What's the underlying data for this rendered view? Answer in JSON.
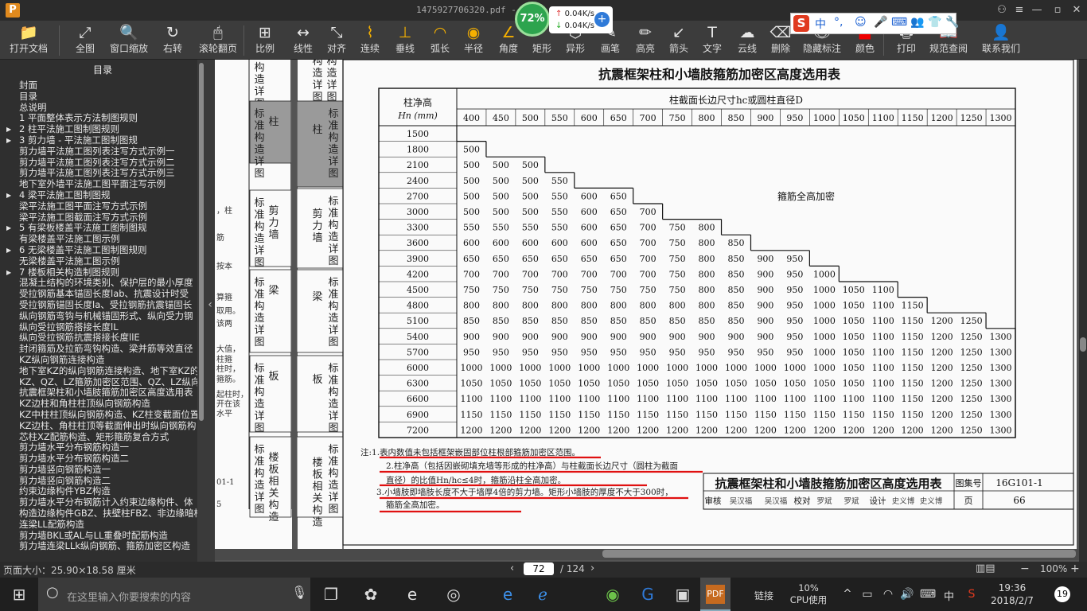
{
  "window": {
    "title": "1475927706320.pdf - P",
    "logo": "P"
  },
  "net_monitor": {
    "percent": "72%",
    "up": "0.04K/s",
    "down": "0.04K/s"
  },
  "ime": {
    "brand": "S",
    "items": [
      "中",
      "°,",
      "☺",
      "🎤",
      "⌨",
      "👥",
      "👕",
      "🔧"
    ]
  },
  "toolbar": [
    {
      "id": "open",
      "icon": "📁",
      "label": "打开文档"
    },
    {
      "id": "fit-all",
      "icon": "⤢",
      "label": "全图"
    },
    {
      "id": "window-zoom",
      "icon": "🔍",
      "label": "窗口缩放"
    },
    {
      "id": "rotate",
      "icon": "↻",
      "label": "右转"
    },
    {
      "id": "scroll-page",
      "icon": "🖱",
      "label": "滚轮翻页"
    },
    {
      "id": "scale",
      "icon": "⊞",
      "label": "比例"
    },
    {
      "id": "linear",
      "icon": "↔",
      "label": "线性"
    },
    {
      "id": "align",
      "icon": "⤡",
      "label": "对齐"
    },
    {
      "id": "continuous",
      "icon": "⌇",
      "label": "连续"
    },
    {
      "id": "perpendicular",
      "icon": "⊥",
      "label": "垂线"
    },
    {
      "id": "arc-length",
      "icon": "◠",
      "label": "弧长"
    },
    {
      "id": "radius",
      "icon": "◉",
      "label": "半径"
    },
    {
      "id": "angle",
      "icon": "∠",
      "label": "角度"
    },
    {
      "id": "rect",
      "icon": "",
      "label": "矩形"
    },
    {
      "id": "polygon",
      "icon": "⬡",
      "label": "异形"
    },
    {
      "id": "brush",
      "icon": "✎",
      "label": "画笔"
    },
    {
      "id": "highlight",
      "icon": "✏",
      "label": "高亮"
    },
    {
      "id": "arrow",
      "icon": "↙",
      "label": "箭头"
    },
    {
      "id": "text",
      "icon": "T",
      "label": "文字"
    },
    {
      "id": "cloud",
      "icon": "☁",
      "label": "云线"
    },
    {
      "id": "erase",
      "icon": "⌫",
      "label": "删除"
    },
    {
      "id": "hide-marks",
      "icon": "👁",
      "label": "隐藏标注"
    },
    {
      "id": "color",
      "icon": "■",
      "label": "颜色"
    },
    {
      "id": "print",
      "icon": "🖶",
      "label": "打印"
    },
    {
      "id": "code-lookup",
      "icon": "📖",
      "label": "规范查阅"
    },
    {
      "id": "contact",
      "icon": "👤",
      "label": "联系我们"
    }
  ],
  "sidebar": {
    "title": "目录",
    "items": [
      {
        "label": "封面",
        "arrow": ""
      },
      {
        "label": "目录",
        "arrow": ""
      },
      {
        "label": "总说明",
        "arrow": ""
      },
      {
        "label": "1 平面整体表示方法制图规则",
        "arrow": ""
      },
      {
        "label": "2 柱平法施工图制图规则",
        "arrow": "▶"
      },
      {
        "label": "3 剪力墙 - 平法施工图制图规",
        "arrow": "▶"
      },
      {
        "label": "剪力墙平法施工图列表注写方式示例一",
        "arrow": ""
      },
      {
        "label": "剪力墙平法施工图列表注写方式示例二",
        "arrow": ""
      },
      {
        "label": "剪力墙平法施工图列表注写方式示例三",
        "arrow": ""
      },
      {
        "label": "地下室外墙平法施工图平面注写示例",
        "arrow": ""
      },
      {
        "label": "4 梁平法施工图制图规",
        "arrow": "▶"
      },
      {
        "label": "梁平法施工图平面注写方式示例",
        "arrow": ""
      },
      {
        "label": "梁平法施工图截面注写方式示例",
        "arrow": ""
      },
      {
        "label": "5 有梁板楼盖平法施工图制图规",
        "arrow": "▶"
      },
      {
        "label": "有梁楼盖平法施工图示例",
        "arrow": ""
      },
      {
        "label": "6 无梁楼盖平法施工图制图规则",
        "arrow": "▶"
      },
      {
        "label": "无梁楼盖平法施工图示例",
        "arrow": ""
      },
      {
        "label": "7 楼板相关构造制图规则",
        "arrow": "▶"
      },
      {
        "label": "混凝土结构的环境类别、保护层的最小厚度",
        "arrow": ""
      },
      {
        "label": "受拉钢筋基本锚固长度lab、抗震设计时受",
        "arrow": ""
      },
      {
        "label": "受拉钢筋锚固长度la、受拉钢筋抗震锚固长",
        "arrow": ""
      },
      {
        "label": "纵向钢筋弯钩与机械锚固形式、纵向受力钢",
        "arrow": ""
      },
      {
        "label": "纵向受拉钢筋搭接长度lL",
        "arrow": ""
      },
      {
        "label": "纵向受拉钢筋抗震搭接长度llE",
        "arrow": ""
      },
      {
        "label": "封闭箍筋及拉筋弯钩构造、梁并筋等效直径",
        "arrow": ""
      },
      {
        "label": "KZ纵向钢筋连接构造",
        "arrow": ""
      },
      {
        "label": "地下室KZ的纵向钢筋连接构造、地下室KZ的",
        "arrow": ""
      },
      {
        "label": "KZ、QZ、LZ箍筋加密区范围、QZ、LZ纵向钢",
        "arrow": ""
      },
      {
        "label": "抗震框架柱和小墙肢箍筋加密区高度选用表",
        "arrow": ""
      },
      {
        "label": "KZ边柱和角柱柱顶纵向钢筋构造",
        "arrow": ""
      },
      {
        "label": "KZ中柱柱顶纵向钢筋构造、KZ柱变截面位置",
        "arrow": ""
      },
      {
        "label": "KZ边柱、角柱柱顶等截面伸出时纵向钢筋构",
        "arrow": ""
      },
      {
        "label": "芯柱XZ配筋构造、矩形箍筋复合方式",
        "arrow": ""
      },
      {
        "label": "剪力墙水平分布钢筋构造一",
        "arrow": ""
      },
      {
        "label": "剪力墙水平分布钢筋构造二",
        "arrow": ""
      },
      {
        "label": "剪力墙竖向钢筋构造一",
        "arrow": ""
      },
      {
        "label": "剪力墙竖向钢筋构造二",
        "arrow": ""
      },
      {
        "label": "约束边缘构件YBZ构造",
        "arrow": ""
      },
      {
        "label": "剪力墙水平分布钢筋计入约束边缘构件、体",
        "arrow": ""
      },
      {
        "label": "构造边缘构件GBZ、扶壁柱FBZ、非边缘暗柱",
        "arrow": ""
      },
      {
        "label": "连梁LL配筋构造",
        "arrow": ""
      },
      {
        "label": "剪力墙BKL或AL与LL重叠时配筋构造",
        "arrow": ""
      },
      {
        "label": "剪力墙连梁LLk纵向钢筋、箍筋加密区构造",
        "arrow": ""
      }
    ]
  },
  "doc": {
    "table_title": "抗震框架柱和小墙肢箍筋加密区高度选用表",
    "corner_line1": "柱净高",
    "corner_line2": "Hn (mm)",
    "header_label": "柱截面长边尺寸hc或圆柱直径D",
    "full_label": "箍筋全高加密",
    "columns": [
      "400",
      "450",
      "500",
      "550",
      "600",
      "650",
      "700",
      "750",
      "800",
      "850",
      "900",
      "950",
      "1000",
      "1050",
      "1100",
      "1150",
      "1200",
      "1250",
      "1300"
    ],
    "rows": [
      {
        "h": "1500",
        "v": []
      },
      {
        "h": "1800",
        "v": [
          "500"
        ]
      },
      {
        "h": "2100",
        "v": [
          "500",
          "500",
          "500"
        ]
      },
      {
        "h": "2400",
        "v": [
          "500",
          "500",
          "500",
          "550"
        ]
      },
      {
        "h": "2700",
        "v": [
          "500",
          "500",
          "500",
          "550",
          "600",
          "650"
        ]
      },
      {
        "h": "3000",
        "v": [
          "500",
          "500",
          "500",
          "550",
          "600",
          "650",
          "700"
        ]
      },
      {
        "h": "3300",
        "v": [
          "550",
          "550",
          "550",
          "550",
          "600",
          "650",
          "700",
          "750",
          "800"
        ]
      },
      {
        "h": "3600",
        "v": [
          "600",
          "600",
          "600",
          "600",
          "600",
          "650",
          "700",
          "750",
          "800",
          "850"
        ]
      },
      {
        "h": "3900",
        "v": [
          "650",
          "650",
          "650",
          "650",
          "650",
          "650",
          "700",
          "750",
          "800",
          "850",
          "900",
          "950"
        ]
      },
      {
        "h": "4200",
        "v": [
          "700",
          "700",
          "700",
          "700",
          "700",
          "700",
          "700",
          "750",
          "800",
          "850",
          "900",
          "950",
          "1000"
        ]
      },
      {
        "h": "4500",
        "v": [
          "750",
          "750",
          "750",
          "750",
          "750",
          "750",
          "750",
          "750",
          "800",
          "850",
          "900",
          "950",
          "1000",
          "1050",
          "1100"
        ]
      },
      {
        "h": "4800",
        "v": [
          "800",
          "800",
          "800",
          "800",
          "800",
          "800",
          "800",
          "800",
          "800",
          "850",
          "900",
          "950",
          "1000",
          "1050",
          "1100",
          "1150"
        ]
      },
      {
        "h": "5100",
        "v": [
          "850",
          "850",
          "850",
          "850",
          "850",
          "850",
          "850",
          "850",
          "850",
          "850",
          "900",
          "950",
          "1000",
          "1050",
          "1100",
          "1150",
          "1200",
          "1250"
        ]
      },
      {
        "h": "5400",
        "v": [
          "900",
          "900",
          "900",
          "900",
          "900",
          "900",
          "900",
          "900",
          "900",
          "900",
          "900",
          "950",
          "1000",
          "1050",
          "1100",
          "1150",
          "1200",
          "1250",
          "1300"
        ]
      },
      {
        "h": "5700",
        "v": [
          "950",
          "950",
          "950",
          "950",
          "950",
          "950",
          "950",
          "950",
          "950",
          "950",
          "950",
          "950",
          "1000",
          "1050",
          "1100",
          "1150",
          "1200",
          "1250",
          "1300"
        ]
      },
      {
        "h": "6000",
        "v": [
          "1000",
          "1000",
          "1000",
          "1000",
          "1000",
          "1000",
          "1000",
          "1000",
          "1000",
          "1000",
          "1000",
          "1000",
          "1000",
          "1050",
          "1100",
          "1150",
          "1200",
          "1250",
          "1300"
        ]
      },
      {
        "h": "6300",
        "v": [
          "1050",
          "1050",
          "1050",
          "1050",
          "1050",
          "1050",
          "1050",
          "1050",
          "1050",
          "1050",
          "1050",
          "1050",
          "1050",
          "1050",
          "1100",
          "1150",
          "1200",
          "1250",
          "1300"
        ]
      },
      {
        "h": "6600",
        "v": [
          "1100",
          "1100",
          "1100",
          "1100",
          "1100",
          "1100",
          "1100",
          "1100",
          "1100",
          "1100",
          "1100",
          "1100",
          "1100",
          "1100",
          "1100",
          "1150",
          "1200",
          "1250",
          "1300"
        ]
      },
      {
        "h": "6900",
        "v": [
          "1150",
          "1150",
          "1150",
          "1150",
          "1150",
          "1150",
          "1150",
          "1150",
          "1150",
          "1150",
          "1150",
          "1150",
          "1150",
          "1150",
          "1150",
          "1150",
          "1200",
          "1250",
          "1300"
        ]
      },
      {
        "h": "7200",
        "v": [
          "1200",
          "1200",
          "1200",
          "1200",
          "1200",
          "1200",
          "1200",
          "1200",
          "1200",
          "1200",
          "1200",
          "1200",
          "1200",
          "1200",
          "1200",
          "1200",
          "1200",
          "1250",
          "1300"
        ]
      }
    ],
    "notes": [
      "注:1.表内数值未包括框架嵌固部位柱根部箍筋加密区范围。",
      "2.柱净高（包括因嵌砌填充墙等形成的柱净高）与柱截面长边尺寸（圆柱为截面",
      "直径）的比值Hn/hc≤4时，箍筋沿柱全高加密。",
      "3.小墙肢即墙肢长度不大于墙厚4倍的剪力墙。矩形小墙肢的厚度不大于300时，",
      "箍筋全高加密。"
    ],
    "footer": {
      "title": "抗震框架柱和小墙肢箍筋加密区高度选用表",
      "atlas_label": "图集号",
      "atlas_no": "16G101-1",
      "page_label": "页",
      "page_no": "66",
      "approvals": [
        "审核",
        "吴汉福",
        "吴汉福",
        "校对",
        "罗斌",
        "罗斌",
        "设计",
        "史义博",
        "史义博"
      ]
    },
    "left_tabs": [
      {
        "name": "column",
        "text": "柱",
        "bg": "#9a9a9a"
      },
      {
        "name": "shear-wall",
        "text": "剪力墙",
        "bg": "#fafafa"
      },
      {
        "name": "beam",
        "text": "梁",
        "bg": "#fafafa"
      },
      {
        "name": "slab",
        "text": "板",
        "bg": "#fafafa"
      },
      {
        "name": "slab-related",
        "text": "楼板相关构造",
        "bg": "#fafafa"
      }
    ],
    "tab_caption": "标准构造详图",
    "top_partial": "构造详图",
    "prev_page_frags": [
      "，柱",
      "筋",
      "按本",
      "算箍",
      "取用。",
      "该两",
      "大值，",
      "柱箍",
      "柱时，",
      "箍筋。",
      "起柱时，",
      "开在该",
      "水平",
      "01-1",
      "5"
    ]
  },
  "statusbar": {
    "page_size": "页面大小：25.90×18.58 厘米",
    "current_page": "72",
    "total_pages": "/ 124",
    "zoom": "100%"
  },
  "taskbar": {
    "search_placeholder": "在这里输入你要搜索的内容",
    "link_label": "链接",
    "cpu_percent": "10%",
    "cpu_label": "CPU使用",
    "ime": "中",
    "time": "19:36",
    "date": "2018/2/7",
    "notif_count": "19"
  }
}
